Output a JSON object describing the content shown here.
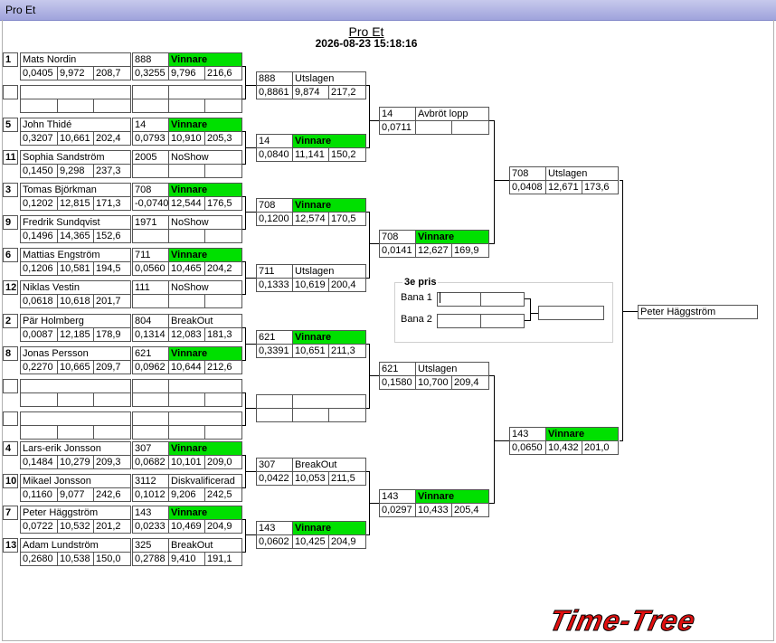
{
  "window_title": "Pro Et",
  "heading": "Pro Et",
  "datetime": "2026-08-23 15:18:16",
  "bronze": {
    "title": "3e pris",
    "lane1": "Bana 1",
    "lane2": "Bana 2"
  },
  "champion": "Peter Häggström",
  "logo": "Time-Tree",
  "rows": [
    {
      "seed": "1",
      "name": "Mats Nordin",
      "rt": "0,0405",
      "et": "9,972",
      "sp": "208,7",
      "r1": {
        "id": "888",
        "status": "Vinnare",
        "win": true,
        "rt": "0,3255",
        "et": "9,796",
        "sp": "216,6"
      }
    },
    {
      "seed": "",
      "name": "",
      "rt": "",
      "et": "",
      "sp": "",
      "r1": {
        "id": "",
        "status": "",
        "win": false,
        "rt": "",
        "et": "",
        "sp": ""
      }
    },
    {
      "seed": "5",
      "name": "John Thidé",
      "rt": "0,3207",
      "et": "10,661",
      "sp": "202,4",
      "r1": {
        "id": "14",
        "status": "Vinnare",
        "win": true,
        "rt": "0,0793",
        "et": "10,910",
        "sp": "205,3"
      }
    },
    {
      "seed": "11",
      "name": "Sophia Sandström",
      "rt": "0,1450",
      "et": "9,298",
      "sp": "237,3",
      "r1": {
        "id": "2005",
        "status": "NoShow",
        "win": false,
        "rt": "",
        "et": "",
        "sp": ""
      }
    },
    {
      "seed": "3",
      "name": "Tomas Björkman",
      "rt": "0,1202",
      "et": "12,815",
      "sp": "171,3",
      "r1": {
        "id": "708",
        "status": "Vinnare",
        "win": true,
        "rt": "-0,0740",
        "et": "12,544",
        "sp": "176,5"
      }
    },
    {
      "seed": "9",
      "name": "Fredrik Sundqvist",
      "rt": "0,1496",
      "et": "14,365",
      "sp": "152,6",
      "r1": {
        "id": "1971",
        "status": "NoShow",
        "win": false,
        "rt": "",
        "et": "",
        "sp": ""
      }
    },
    {
      "seed": "6",
      "name": "Mattias Engström",
      "rt": "0,1206",
      "et": "10,581",
      "sp": "194,5",
      "r1": {
        "id": "711",
        "status": "Vinnare",
        "win": true,
        "rt": "0,0560",
        "et": "10,465",
        "sp": "204,2"
      }
    },
    {
      "seed": "12",
      "name": "Niklas  Vestin",
      "rt": "0,0618",
      "et": "10,618",
      "sp": "201,7",
      "r1": {
        "id": "111",
        "status": "NoShow",
        "win": false,
        "rt": "",
        "et": "",
        "sp": ""
      }
    },
    {
      "seed": "2",
      "name": "Pär Holmberg",
      "rt": "0,0087",
      "et": "12,185",
      "sp": "178,9",
      "r1": {
        "id": "804",
        "status": "BreakOut",
        "win": false,
        "rt": "0,1314",
        "et": "12,083",
        "sp": "181,3"
      }
    },
    {
      "seed": "8",
      "name": "Jonas Persson",
      "rt": "0,2270",
      "et": "10,665",
      "sp": "209,7",
      "r1": {
        "id": "621",
        "status": "Vinnare",
        "win": true,
        "rt": "0,0962",
        "et": "10,644",
        "sp": "212,6"
      }
    },
    {
      "seed": "",
      "name": "",
      "rt": "",
      "et": "",
      "sp": "",
      "r1": {
        "id": "",
        "status": "",
        "win": false,
        "rt": "",
        "et": "",
        "sp": ""
      }
    },
    {
      "seed": "",
      "name": "",
      "rt": "",
      "et": "",
      "sp": "",
      "r1": {
        "id": "",
        "status": "",
        "win": false,
        "rt": "",
        "et": "",
        "sp": ""
      }
    },
    {
      "seed": "4",
      "name": "Lars-erik Jonsson",
      "rt": "0,1484",
      "et": "10,279",
      "sp": "209,3",
      "r1": {
        "id": "307",
        "status": "Vinnare",
        "win": true,
        "rt": "0,0682",
        "et": "10,101",
        "sp": "209,0"
      }
    },
    {
      "seed": "10",
      "name": "Mikael Jonsson",
      "rt": "0,1160",
      "et": "9,077",
      "sp": "242,6",
      "r1": {
        "id": "3112",
        "status": "Diskvalificerad",
        "win": false,
        "rt": "0,1012",
        "et": "9,206",
        "sp": "242,5"
      }
    },
    {
      "seed": "7",
      "name": "Peter Häggström",
      "rt": "0,0722",
      "et": "10,532",
      "sp": "201,2",
      "r1": {
        "id": "143",
        "status": "Vinnare",
        "win": true,
        "rt": "0,0233",
        "et": "10,469",
        "sp": "204,9"
      }
    },
    {
      "seed": "13",
      "name": "Adam Lundström",
      "rt": "0,2680",
      "et": "10,538",
      "sp": "150,0",
      "r1": {
        "id": "325",
        "status": "BreakOut",
        "win": false,
        "rt": "0,2788",
        "et": "9,410",
        "sp": "191,1"
      }
    }
  ],
  "round2": [
    {
      "id": "888",
      "status": "Utslagen",
      "win": false,
      "rt": "0,8861",
      "et": "9,874",
      "sp": "217,2"
    },
    {
      "id": "14",
      "status": "Vinnare",
      "win": true,
      "rt": "0,0840",
      "et": "11,141",
      "sp": "150,2"
    },
    {
      "id": "708",
      "status": "Vinnare",
      "win": true,
      "rt": "0,1200",
      "et": "12,574",
      "sp": "170,5"
    },
    {
      "id": "711",
      "status": "Utslagen",
      "win": false,
      "rt": "0,1333",
      "et": "10,619",
      "sp": "200,4"
    },
    {
      "id": "621",
      "status": "Vinnare",
      "win": true,
      "rt": "0,3391",
      "et": "10,651",
      "sp": "211,3"
    },
    {
      "id": "",
      "status": "",
      "win": false,
      "rt": "",
      "et": "",
      "sp": ""
    },
    {
      "id": "307",
      "status": "BreakOut",
      "win": false,
      "rt": "0,0422",
      "et": "10,053",
      "sp": "211,5"
    },
    {
      "id": "143",
      "status": "Vinnare",
      "win": true,
      "rt": "0,0602",
      "et": "10,425",
      "sp": "204,9"
    }
  ],
  "round3": [
    {
      "id": "14",
      "status": "Avbröt lopp",
      "win": false,
      "rt": "0,0711",
      "et": "",
      "sp": ""
    },
    {
      "id": "708",
      "status": "Vinnare",
      "win": true,
      "rt": "0,0141",
      "et": "12,627",
      "sp": "169,9"
    },
    {
      "id": "621",
      "status": "Utslagen",
      "win": false,
      "rt": "0,1580",
      "et": "10,700",
      "sp": "209,4"
    },
    {
      "id": "143",
      "status": "Vinnare",
      "win": true,
      "rt": "0,0297",
      "et": "10,433",
      "sp": "205,4"
    }
  ],
  "round4": [
    {
      "id": "708",
      "status": "Utslagen",
      "win": false,
      "rt": "0,0408",
      "et": "12,671",
      "sp": "173,6"
    },
    {
      "id": "143",
      "status": "Vinnare",
      "win": true,
      "rt": "0,0650",
      "et": "10,432",
      "sp": "201,0"
    }
  ]
}
